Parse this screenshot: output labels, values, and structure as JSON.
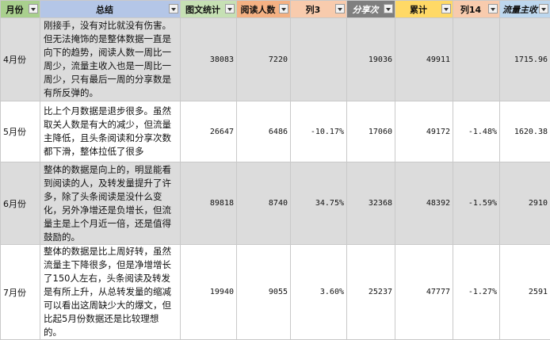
{
  "headers": {
    "month": "月份",
    "summary": "总结",
    "graphic": "图文统计",
    "readers": "阅读人数",
    "col3": "列3",
    "share": "分享次",
    "total": "累计",
    "col14": "列14",
    "streamer": "流量主收"
  },
  "rows": [
    {
      "month": "4月份",
      "summary": "刚接手，没有对比就没有伤害。但无法掩饰的是整体数据一直是向下的趋势，阅读人数一周比一周少，流量主收入也是一周比一周少，只有最后一周的分享数是有所反弹的。",
      "graphic": "38083",
      "readers": "7220",
      "col3": "",
      "share": "19036",
      "total": "49911",
      "col14": "",
      "streamer": "1715.96"
    },
    {
      "month": "5月份",
      "summary": "比上个月数据是退步很多。虽然取关人数是有大的减少，但流量主降低，且头条阅读和分享次数都下滑，整体拉低了很多",
      "graphic": "26647",
      "readers": "6486",
      "col3": "-10.17%",
      "share": "17060",
      "total": "49172",
      "col14": "-1.48%",
      "streamer": "1620.38"
    },
    {
      "month": "6月份",
      "summary": "整体的数据是向上的，明显能看到阅读的人，及转发量提升了许多，除了头条阅读是没什么变化，另外净增还是负增长，但流量主是上个月近一倍，还是值得鼓励的。",
      "graphic": "89818",
      "readers": "8740",
      "col3": "34.75%",
      "share": "32368",
      "total": "48392",
      "col14": "-1.59%",
      "streamer": "2910"
    },
    {
      "month": "7月份",
      "summary": "整体的数据是比上周好转，虽然流量主下降很多，但是净增增长了150人左右，头条阅读及转发是有所上升，从总转发量的缩减可以看出这周缺少大的爆文，但比起5月份数据还是比较理想的。",
      "graphic": "19940",
      "readers": "9055",
      "col3": "3.60%",
      "share": "25237",
      "total": "47777",
      "col14": "-1.27%",
      "streamer": "2591"
    }
  ]
}
